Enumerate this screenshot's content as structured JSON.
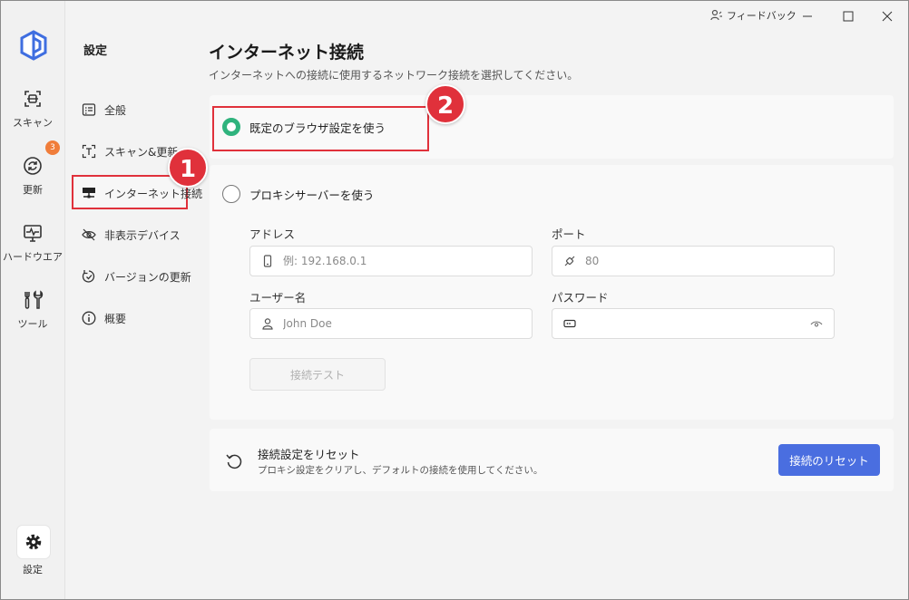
{
  "titlebar": {
    "feedback_label": "フィードバック"
  },
  "rail": {
    "items": [
      {
        "label": "スキャン",
        "icon": "scan-icon"
      },
      {
        "label": "更新",
        "icon": "refresh-icon",
        "badge": "3"
      },
      {
        "label": "ハードウエア",
        "icon": "hardware-monitor-icon"
      },
      {
        "label": "ツール",
        "icon": "tools-icon"
      }
    ],
    "settings_label": "設定"
  },
  "nav": {
    "title": "設定",
    "items": [
      {
        "label": "全般",
        "icon": "general-icon"
      },
      {
        "label": "スキャン&更新",
        "icon": "scan-update-icon"
      },
      {
        "label": "インターネット接続",
        "icon": "network-icon"
      },
      {
        "label": "非表示デバイス",
        "icon": "eye-off-icon"
      },
      {
        "label": "バージョンの更新",
        "icon": "version-update-icon"
      },
      {
        "label": "概要",
        "icon": "info-icon"
      }
    ]
  },
  "main": {
    "title": "インターネット接続",
    "subtitle": "インターネットへの接続に使用するネットワーク接続を選択してください。",
    "option_browser": "既定のブラウザ設定を使う",
    "option_proxy": "プロキシサーバーを使う",
    "address_label": "アドレス",
    "address_placeholder": "例: 192.168.0.1",
    "port_label": "ポート",
    "port_placeholder": "80",
    "username_label": "ユーザー名",
    "username_placeholder": "John Doe",
    "password_label": "パスワード",
    "test_button": "接続テスト",
    "reset_title": "接続設定をリセット",
    "reset_desc": "プロキシ設定をクリアし、デフォルトの接続を使用してください。",
    "reset_button": "接続のリセット"
  },
  "annotations": {
    "marker_1": "1",
    "marker_2": "2"
  },
  "colors": {
    "accent_blue": "#4a6ee0",
    "radio_green": "#2fb37d",
    "highlight_red": "#e0313b",
    "badge_orange": "#f07d3a"
  }
}
